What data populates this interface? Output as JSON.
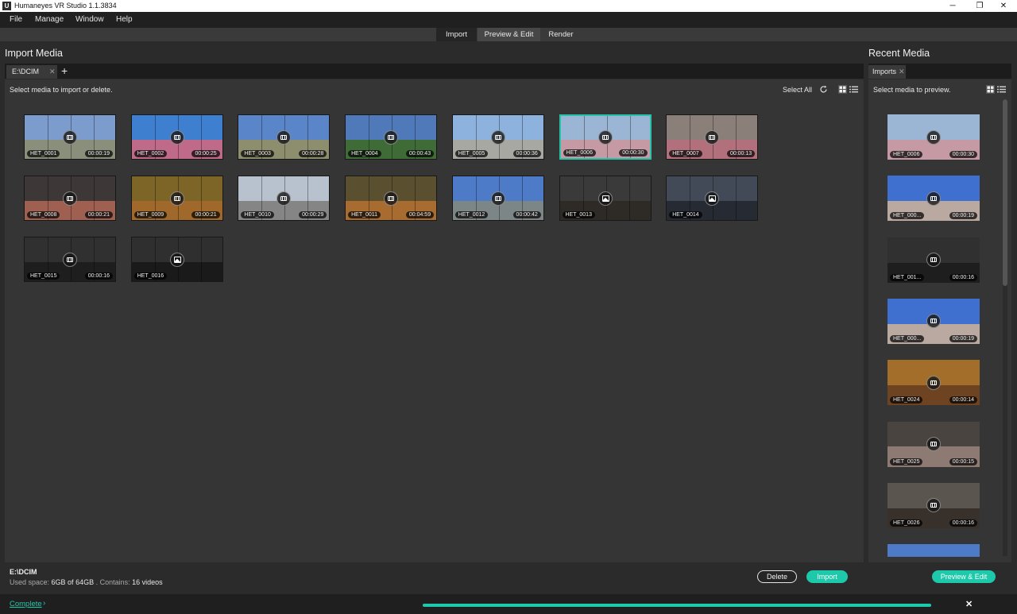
{
  "window": {
    "title": "Humaneyes VR Studio 1.1.3834",
    "icon_letter": "U"
  },
  "menu": [
    "File",
    "Manage",
    "Window",
    "Help"
  ],
  "modes": [
    {
      "label": "Import",
      "state": "active"
    },
    {
      "label": "Preview & Edit",
      "state": "normal"
    },
    {
      "label": "Render",
      "state": "normal"
    }
  ],
  "import_panel": {
    "title": "Import Media",
    "tab_label": "E:\\DCIM",
    "hint": "Select media to import or delete.",
    "select_all": "Select All",
    "items": [
      {
        "name": "HET_0001",
        "duration": "00:00:19",
        "kind": "video",
        "sky": "#7b9ccc",
        "ground": "#8a8f7c"
      },
      {
        "name": "HET_0002",
        "duration": "00:00:25",
        "kind": "video",
        "sky": "#3f7fd0",
        "ground": "#c06a8a"
      },
      {
        "name": "HET_0003",
        "duration": "00:00:28",
        "kind": "video",
        "sky": "#5a86c9",
        "ground": "#8d8e6e"
      },
      {
        "name": "HET_0004",
        "duration": "00:00:43",
        "kind": "video",
        "sky": "#4f79b8",
        "ground": "#3f6b36"
      },
      {
        "name": "HET_0005",
        "duration": "00:00:36",
        "kind": "video",
        "sky": "#8db2dd",
        "ground": "#a8a8a3"
      },
      {
        "name": "HET_0006",
        "duration": "00:00:30",
        "kind": "video",
        "sky": "#9ab6d4",
        "ground": "#c69aa4",
        "selected": true
      },
      {
        "name": "HET_0007",
        "duration": "00:00:13",
        "kind": "video",
        "sky": "#8a8079",
        "ground": "#b26f7c"
      },
      {
        "name": "HET_0008",
        "duration": "00:00:21",
        "kind": "video",
        "sky": "#3d3837",
        "ground": "#9f6052"
      },
      {
        "name": "HET_0009",
        "duration": "00:00:21",
        "kind": "video",
        "sky": "#7d6528",
        "ground": "#a0682a"
      },
      {
        "name": "HET_0010",
        "duration": "00:00:29",
        "kind": "video",
        "sky": "#b8c2cf",
        "ground": "#858585"
      },
      {
        "name": "HET_0011",
        "duration": "00:04:59",
        "kind": "video",
        "sky": "#5a5030",
        "ground": "#a86b30"
      },
      {
        "name": "HET_0012",
        "duration": "00:00:42",
        "kind": "video",
        "sky": "#4d7bc7",
        "ground": "#7d8686"
      },
      {
        "name": "HET_0013",
        "duration": "",
        "kind": "photo",
        "sky": "#3a3a3a",
        "ground": "#2e2a25"
      },
      {
        "name": "HET_0014",
        "duration": "",
        "kind": "photo",
        "sky": "#424a58",
        "ground": "#262a33"
      },
      {
        "name": "HET_0015",
        "duration": "00:00:16",
        "kind": "video",
        "sky": "#303030",
        "ground": "#1e1e1e"
      },
      {
        "name": "HET_0016",
        "duration": "",
        "kind": "photo",
        "sky": "#2f2f2f",
        "ground": "#1a1a1a"
      }
    ],
    "info": {
      "path": "E:\\DCIM",
      "used_label": "Used space:",
      "used_value": "6GB of 64GB",
      "contains_label": ". Contains:",
      "contains_value": "16 videos"
    },
    "delete_label": "Delete",
    "import_label": "Import"
  },
  "recent_panel": {
    "title": "Recent Media",
    "tab_label": "Imports",
    "hint": "Select media to preview.",
    "items": [
      {
        "name": "HET_0006",
        "duration": "00:00:30",
        "sky": "#9ab6d4",
        "ground": "#c69aa4"
      },
      {
        "name": "HET_000...",
        "duration": "00:00:19",
        "sky": "#3f6fcf",
        "ground": "#b9a9a0"
      },
      {
        "name": "HET_001...",
        "duration": "00:00:16",
        "sky": "#303030",
        "ground": "#1e1e1e"
      },
      {
        "name": "HET_000...",
        "duration": "00:00:19",
        "sky": "#3f6fcf",
        "ground": "#b9a9a0"
      },
      {
        "name": "HET_0024",
        "duration": "00:00:14",
        "sky": "#a36d2a",
        "ground": "#6d4322"
      },
      {
        "name": "HET_0025",
        "duration": "00:00:15",
        "sky": "#4a4440",
        "ground": "#8d7a72"
      },
      {
        "name": "HET_0026",
        "duration": "00:00:16",
        "sky": "#5b5550",
        "ground": "#37302b"
      }
    ],
    "preview_edit_label": "Preview & Edit"
  },
  "status": {
    "label": "Complete",
    "progress_fraction": 1.0
  }
}
